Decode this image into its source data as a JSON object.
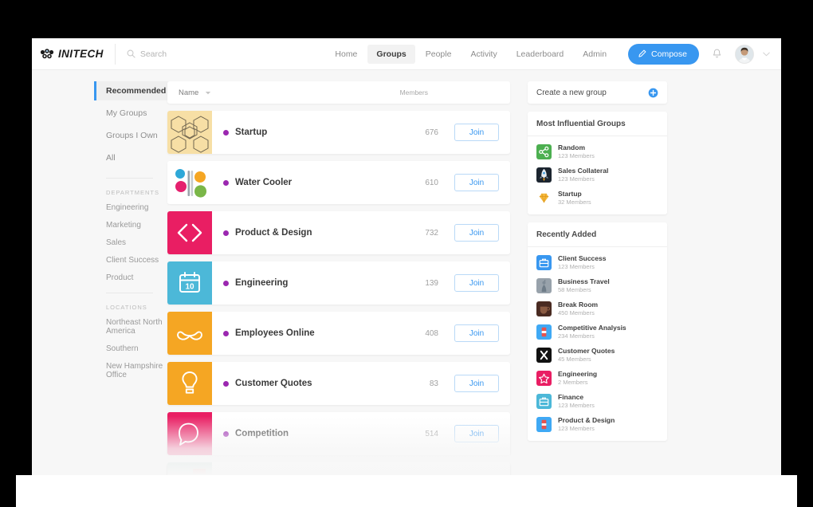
{
  "brand": {
    "name": "INITECH",
    "logo_icon": "dots-cluster-icon"
  },
  "search": {
    "placeholder": "Search",
    "value": "",
    "icon": "search-icon"
  },
  "nav": {
    "items": [
      {
        "label": "Home",
        "active": false
      },
      {
        "label": "Groups",
        "active": true
      },
      {
        "label": "People",
        "active": false
      },
      {
        "label": "Activity",
        "active": false
      },
      {
        "label": "Leaderboard",
        "active": false
      },
      {
        "label": "Admin",
        "active": false
      }
    ],
    "compose_label": "Compose",
    "compose_icon": "pencil-icon",
    "notifications_icon": "bell-icon",
    "avatar_icon": "user-avatar",
    "caret_icon": "chevron-down-icon",
    "accent_color": "#3897f0"
  },
  "sidebar": {
    "primary": [
      {
        "label": "Recommended",
        "active": true
      },
      {
        "label": "My Groups",
        "active": false
      },
      {
        "label": "Groups I Own",
        "active": false
      },
      {
        "label": "All",
        "active": false
      }
    ],
    "departments_heading": "DEPARTMENTS",
    "departments": [
      {
        "label": "Engineering"
      },
      {
        "label": "Marketing"
      },
      {
        "label": "Sales"
      },
      {
        "label": "Client Success"
      },
      {
        "label": "Product"
      }
    ],
    "locations_heading": "LOCATIONS",
    "locations": [
      {
        "label": "Northeast North America"
      },
      {
        "label": "Southern"
      },
      {
        "label": "New Hampshire Office"
      }
    ]
  },
  "list": {
    "header": {
      "name_label": "Name",
      "sort_icon": "caret-down-icon",
      "members_label": "Members"
    },
    "join_label": "Join",
    "status_dot_color": "#9b27b0",
    "rows": [
      {
        "name": "Startup",
        "members": "676",
        "icon": "hexagons-icon",
        "bg": "#f7dfa5"
      },
      {
        "name": "Water Cooler",
        "members": "610",
        "icon": "petals-icon",
        "bg": "#ffffff"
      },
      {
        "name": "Product & Design",
        "members": "732",
        "icon": "code-brackets-icon",
        "bg": "#e91e63"
      },
      {
        "name": "Engineering",
        "members": "139",
        "icon": "calendar-10-icon",
        "bg": "#4cb8d8"
      },
      {
        "name": "Employees Online",
        "members": "408",
        "icon": "mustache-icon",
        "bg": "#f5a623"
      },
      {
        "name": "Customer Quotes",
        "members": "83",
        "icon": "lightbulb-icon",
        "bg": "#f5a623"
      },
      {
        "name": "Competition",
        "members": "514",
        "icon": "speech-bubble-icon",
        "bg": "#e91e63"
      },
      {
        "name": "",
        "members": "",
        "icon": "landscape-icon",
        "bg": "#8fb8ad"
      }
    ]
  },
  "rail": {
    "create_label": "Create a new group",
    "create_icon": "plus-circle-icon",
    "influential_title": "Most Influential Groups",
    "influential": [
      {
        "name": "Random",
        "members": "123 Members",
        "icon": "share-icon",
        "bg": "#4caf50"
      },
      {
        "name": "Sales Collateral",
        "members": "123 Members",
        "icon": "rocket-icon",
        "bg": "#1c2530"
      },
      {
        "name": "Startup",
        "members": "32 Members",
        "icon": "diamond-icon",
        "bg": "#ffffff"
      }
    ],
    "recent_title": "Recently Added",
    "recent": [
      {
        "name": "Client Success",
        "members": "123 Members",
        "icon": "briefcase-icon",
        "bg": "#3897f0"
      },
      {
        "name": "Business Travel",
        "members": "58 Members",
        "icon": "statue-icon",
        "bg": "#8b95a0"
      },
      {
        "name": "Break Room",
        "members": "450 Members",
        "icon": "coffee-icon",
        "bg": "#4a2b22"
      },
      {
        "name": "Competitive Analysis",
        "members": "234 Members",
        "icon": "soda-can-icon",
        "bg": "#3fa9f5"
      },
      {
        "name": "Customer Quotes",
        "members": "45 Members",
        "icon": "x-mark-icon",
        "bg": "#111111"
      },
      {
        "name": "Engineering",
        "members": "2 Members",
        "icon": "star-icon",
        "bg": "#e91e63"
      },
      {
        "name": "Finance",
        "members": "123 Members",
        "icon": "briefcase-icon",
        "bg": "#4cb8d8"
      },
      {
        "name": "Product & Design",
        "members": "123 Members",
        "icon": "soda-can-icon",
        "bg": "#3fa9f5"
      }
    ]
  }
}
